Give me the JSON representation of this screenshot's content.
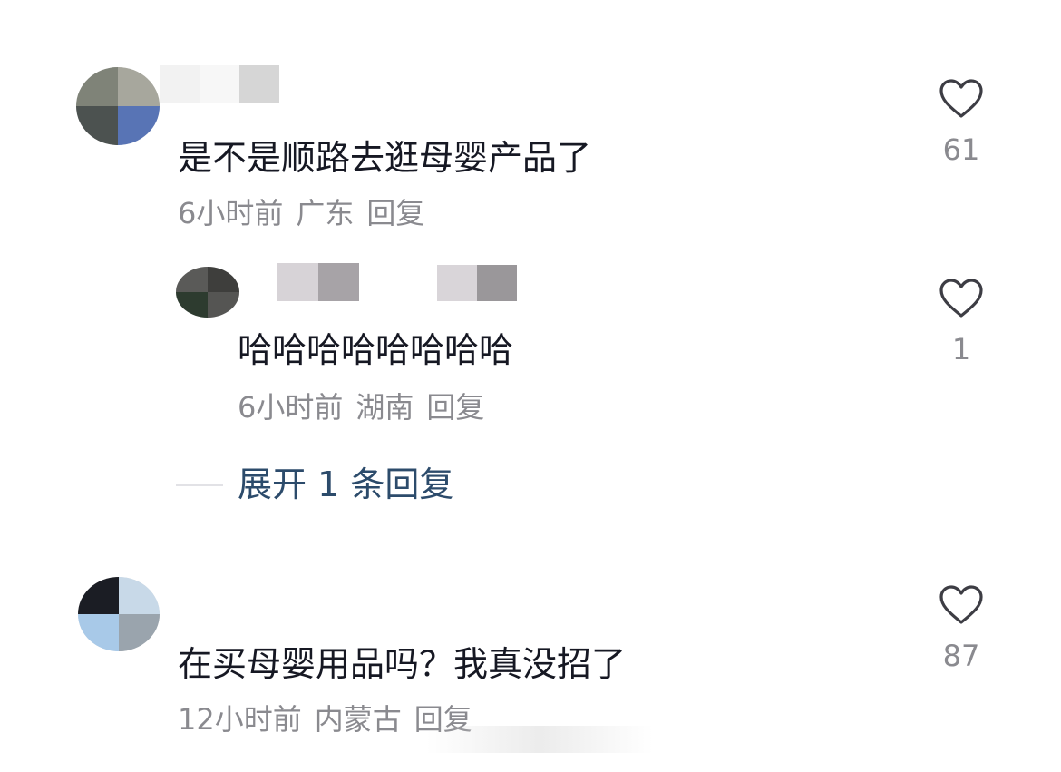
{
  "comments": [
    {
      "text": "是不是顺路去逛母婴产品了",
      "time": "6小时前",
      "location": "广东",
      "reply_label": "回复",
      "likes": "61"
    },
    {
      "text": "哈哈哈哈哈哈哈哈",
      "time": "6小时前",
      "location": "湖南",
      "reply_label": "回复",
      "likes": "1"
    },
    {
      "text": "在买母婴用品吗？我真没招了",
      "time": "12小时前",
      "location": "内蒙古",
      "reply_label": "回复",
      "likes": "87"
    }
  ],
  "expand_replies_label": "展开 1 条回复",
  "icons": {
    "like": "heart-outline-icon"
  },
  "colors": {
    "text": "#161823",
    "meta": "#8a8a8f",
    "link": "#2c4b6b"
  }
}
